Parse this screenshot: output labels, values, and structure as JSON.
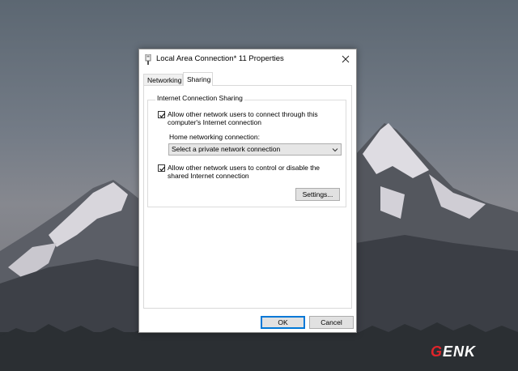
{
  "dialog": {
    "title": "Local Area Connection* 11 Properties",
    "close_glyph": "✕"
  },
  "tabs": [
    {
      "label": "Networking",
      "active": false
    },
    {
      "label": "Sharing",
      "active": true
    }
  ],
  "sharing": {
    "group_label": "Internet Connection Sharing",
    "allow_connect": {
      "label": "Allow other network users to connect through this computer's Internet connection",
      "checked": true
    },
    "home_networking_label": "Home networking connection:",
    "home_networking_select": {
      "value": "Select a private network connection"
    },
    "allow_control": {
      "label": "Allow other network users to control or disable the shared Internet connection",
      "checked": true
    },
    "settings_label": "Settings..."
  },
  "footer": {
    "ok_label": "OK",
    "cancel_label": "Cancel"
  },
  "watermark": {
    "accent_text": "G",
    "text": "ENK"
  },
  "icons": {
    "title_icon": "network-adapter-icon",
    "close_icon": "close-icon",
    "checkbox_icon": "checkmark-icon",
    "dropdown_icon": "chevron-down-icon"
  },
  "colors": {
    "accent": "#0078d7",
    "watermark_accent": "#e0242a"
  }
}
